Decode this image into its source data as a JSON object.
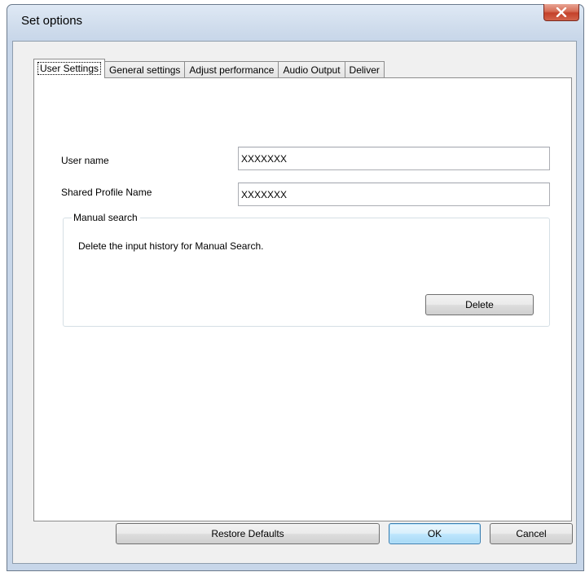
{
  "window": {
    "title": "Set options"
  },
  "tabs": [
    {
      "label": "User Settings",
      "active": true
    },
    {
      "label": "General settings",
      "active": false
    },
    {
      "label": "Adjust performance",
      "active": false
    },
    {
      "label": "Audio Output",
      "active": false
    },
    {
      "label": "Deliver",
      "active": false
    }
  ],
  "user_settings": {
    "user_name_label": "User name",
    "user_name_value": "XXXXXXX",
    "shared_profile_label": "Shared Profile Name",
    "shared_profile_value": "XXXXXXX",
    "manual_search": {
      "title": "Manual search",
      "description": "Delete the input history for Manual Search.",
      "delete_label": "Delete"
    }
  },
  "footer": {
    "restore_defaults_label": "Restore Defaults",
    "ok_label": "OK",
    "cancel_label": "Cancel"
  },
  "icons": {
    "close": "close-icon"
  },
  "colors": {
    "close_button": "#c4412a",
    "default_button_border": "#3c7fb1",
    "window_frame": "#c7d6e9"
  }
}
